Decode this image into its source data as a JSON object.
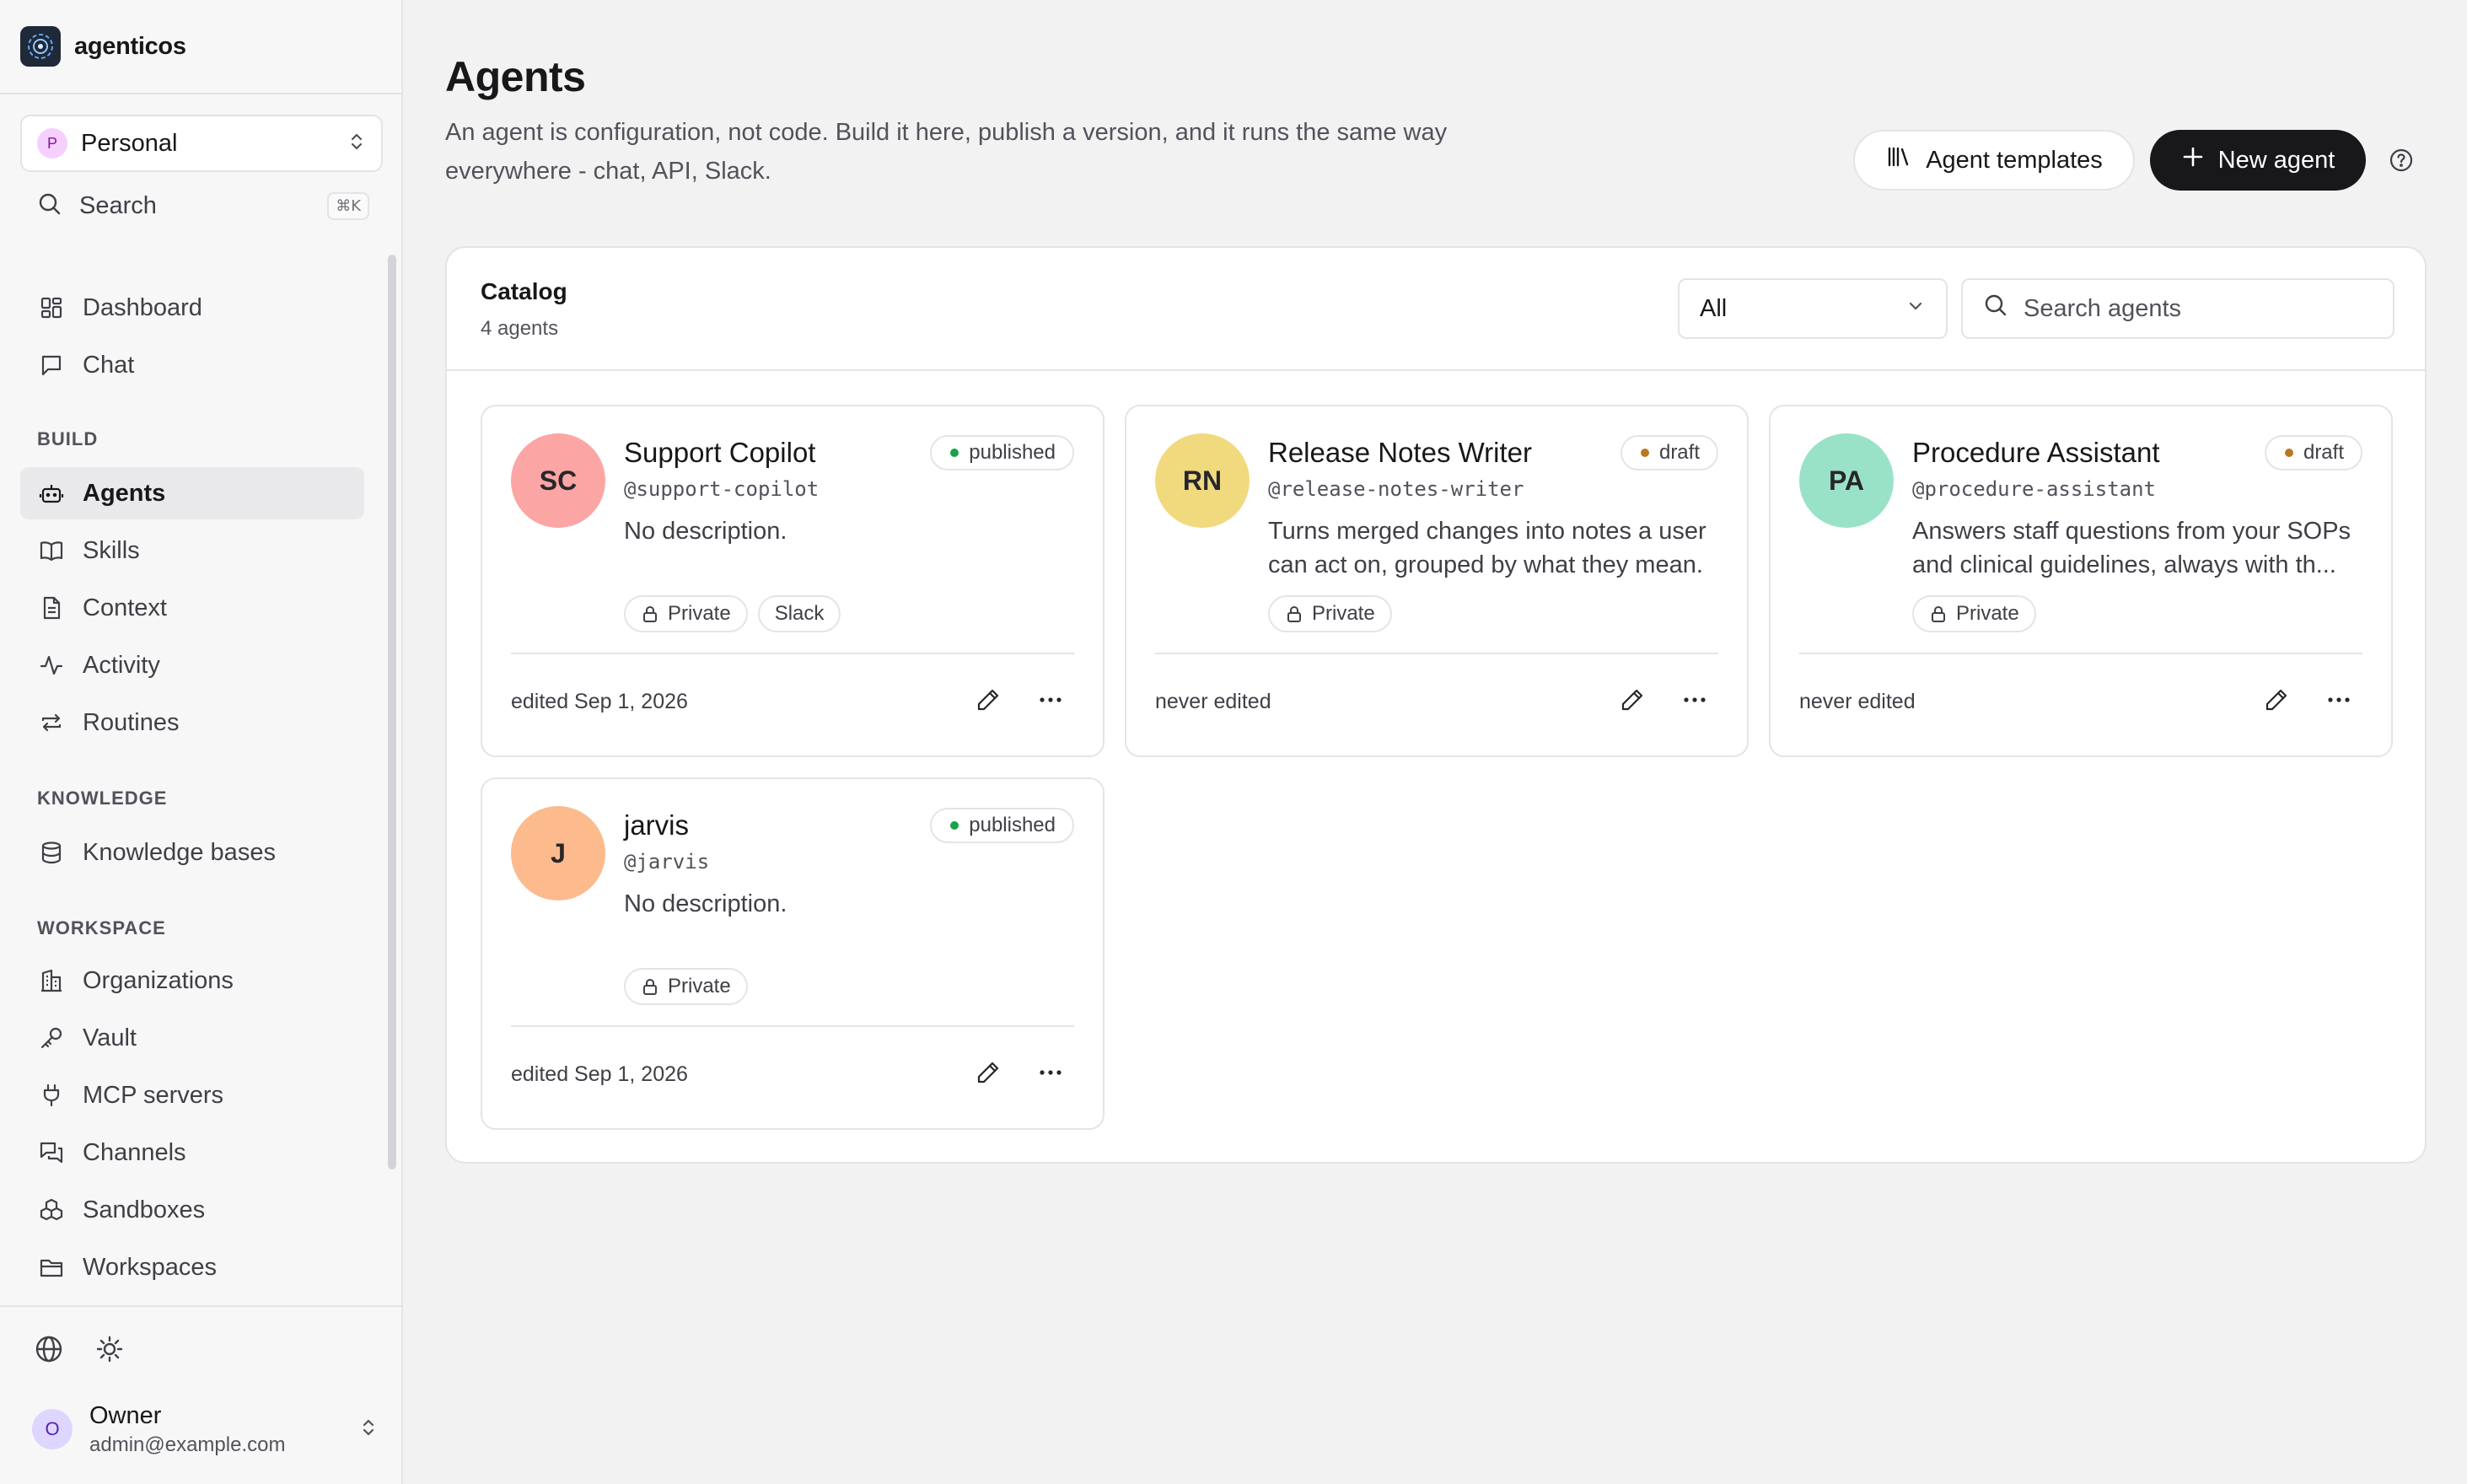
{
  "app": {
    "brand": "agenticos"
  },
  "workspace": {
    "initial": "P",
    "name": "Personal"
  },
  "search": {
    "label": "Search",
    "shortcut": "⌘K"
  },
  "sidebar": {
    "top_items": [
      {
        "label": "Dashboard",
        "icon": "dashboard-icon"
      },
      {
        "label": "Chat",
        "icon": "chat-icon"
      }
    ],
    "sections": [
      {
        "title": "BUILD",
        "items": [
          {
            "label": "Agents",
            "icon": "robot-icon",
            "active": true
          },
          {
            "label": "Skills",
            "icon": "book-icon"
          },
          {
            "label": "Context",
            "icon": "document-icon"
          },
          {
            "label": "Activity",
            "icon": "activity-icon"
          },
          {
            "label": "Routines",
            "icon": "repeat-icon"
          }
        ]
      },
      {
        "title": "KNOWLEDGE",
        "items": [
          {
            "label": "Knowledge bases",
            "icon": "database-icon"
          }
        ]
      },
      {
        "title": "WORKSPACE",
        "items": [
          {
            "label": "Organizations",
            "icon": "building-icon"
          },
          {
            "label": "Vault",
            "icon": "key-icon"
          },
          {
            "label": "MCP servers",
            "icon": "plug-icon"
          },
          {
            "label": "Channels",
            "icon": "messages-icon"
          },
          {
            "label": "Sandboxes",
            "icon": "boxes-icon"
          },
          {
            "label": "Workspaces",
            "icon": "folder-icon"
          }
        ]
      }
    ]
  },
  "user": {
    "initial": "O",
    "name": "Owner",
    "email": "admin@example.com"
  },
  "page": {
    "title": "Agents",
    "description": "An agent is configuration, not code. Build it here, publish a version, and it runs the same way everywhere - chat, API, Slack.",
    "templates_button": "Agent templates",
    "new_button": "New agent"
  },
  "catalog": {
    "title": "Catalog",
    "count": "4 agents",
    "filter_value": "All",
    "search_placeholder": "Search agents",
    "agents": [
      {
        "initials": "SC",
        "avatar_color": "#fca5a5",
        "name": "Support Copilot",
        "handle": "@support-copilot",
        "status": "published",
        "status_color": "#16a34a",
        "description": "No description.",
        "tags": [
          "Private",
          "Slack"
        ],
        "edited": "edited Sep 1, 2026"
      },
      {
        "initials": "RN",
        "avatar_color": "#f1d97e",
        "name": "Release Notes Writer",
        "handle": "@release-notes-writer",
        "status": "draft",
        "status_color": "#b7791f",
        "description": "Turns merged changes into notes a user can act on, grouped by what they mean.",
        "tags": [
          "Private"
        ],
        "edited": "never edited"
      },
      {
        "initials": "PA",
        "avatar_color": "#99e2c8",
        "name": "Procedure Assistant",
        "handle": "@procedure-assistant",
        "status": "draft",
        "status_color": "#b7791f",
        "description": "Answers staff questions from your SOPs and clinical guidelines, always with th...",
        "tags": [
          "Private"
        ],
        "edited": "never edited"
      },
      {
        "initials": "J",
        "avatar_color": "#fdba8c",
        "name": "jarvis",
        "handle": "@jarvis",
        "status": "published",
        "status_color": "#16a34a",
        "description": "No description.",
        "tags": [
          "Private"
        ],
        "edited": "edited Sep 1, 2026"
      }
    ]
  }
}
